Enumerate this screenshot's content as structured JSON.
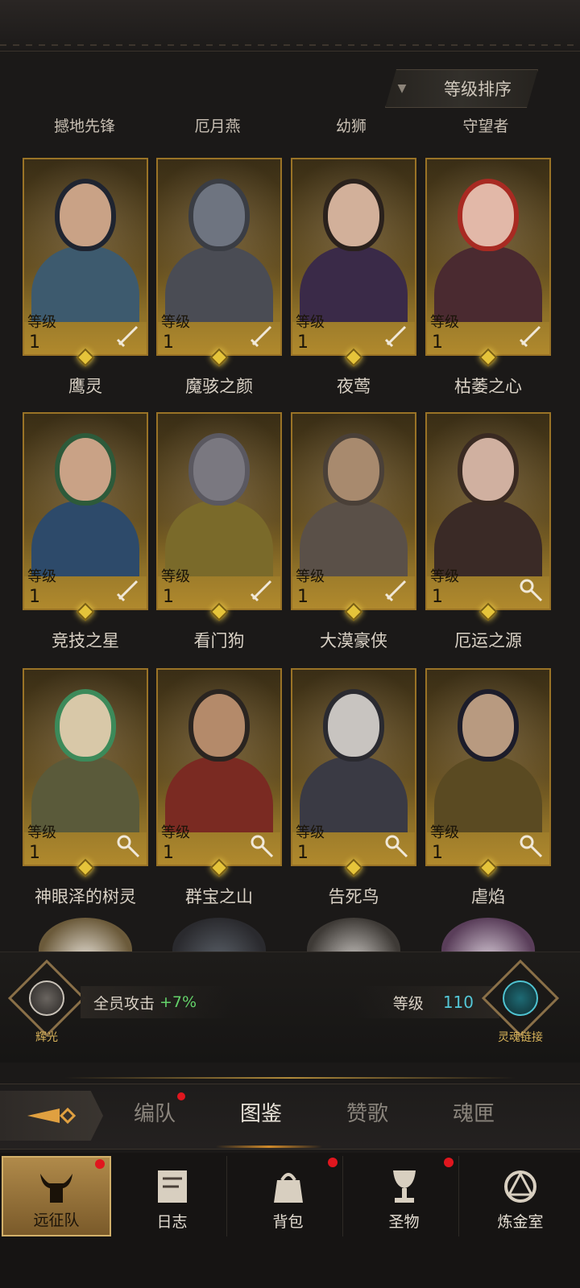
{
  "sort": {
    "label": "等级排序"
  },
  "cut_row": [
    "撼地先锋",
    "厄月燕",
    "幼狮",
    "守望者"
  ],
  "level_label": "等级",
  "heroes": [
    {
      "name": "鹰灵",
      "level": "1",
      "class_icon": "sword-icon"
    },
    {
      "name": "魔骇之颜",
      "level": "1",
      "class_icon": "sword-icon"
    },
    {
      "name": "夜莺",
      "level": "1",
      "class_icon": "sword-icon"
    },
    {
      "name": "枯萎之心",
      "level": "1",
      "class_icon": "sword-icon"
    },
    {
      "name": "竞技之星",
      "level": "1",
      "class_icon": "sword-icon"
    },
    {
      "name": "看门狗",
      "level": "1",
      "class_icon": "sword-icon"
    },
    {
      "name": "大漠豪侠",
      "level": "1",
      "class_icon": "sword-icon"
    },
    {
      "name": "厄运之源",
      "level": "1",
      "class_icon": "staff-icon"
    },
    {
      "name": "神眼泽的树灵",
      "level": "1",
      "class_icon": "staff-icon"
    },
    {
      "name": "群宝之山",
      "level": "1",
      "class_icon": "staff-icon"
    },
    {
      "name": "告死鸟",
      "level": "1",
      "class_icon": "staff-icon"
    },
    {
      "name": "虐焰",
      "level": "1",
      "class_icon": "staff-icon"
    }
  ],
  "info": {
    "left_badge": "辉光",
    "buff_label": "全员攻击",
    "buff_value": "+7%",
    "level_label": "等级",
    "level_value": "110",
    "right_badge": "灵魂链接"
  },
  "subtabs": [
    {
      "label": "编队",
      "dot": true
    },
    {
      "label": "图鉴",
      "active": true
    },
    {
      "label": "赞歌"
    },
    {
      "label": "魂匣"
    }
  ],
  "nav": [
    {
      "label": "远征队",
      "icon": "horned-helmet-icon",
      "active": true,
      "dot": true
    },
    {
      "label": "日志",
      "icon": "scroll-icon"
    },
    {
      "label": "背包",
      "icon": "bag-icon",
      "dot": true
    },
    {
      "label": "圣物",
      "icon": "chalice-icon",
      "dot": true
    },
    {
      "label": "炼金室",
      "icon": "alchemy-icon"
    }
  ],
  "colors": {
    "card_border": "#9a7326",
    "buff_green": "#64d36a",
    "level_cyan": "#53c6d6",
    "notify_red": "#e0161e"
  }
}
